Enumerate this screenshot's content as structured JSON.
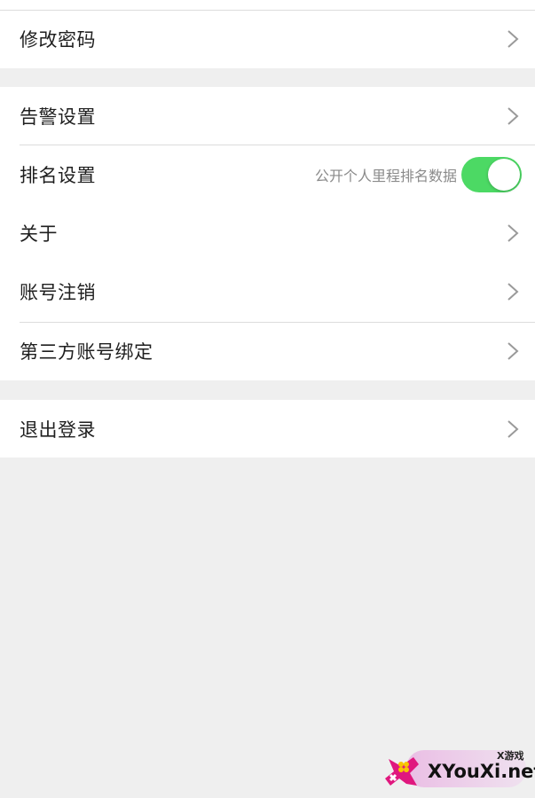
{
  "settings": {
    "change_password": "修改密码",
    "alarm_settings": "告警设置",
    "ranking_settings": "排名设置",
    "ranking_hint": "公开个人里程排名数据",
    "ranking_toggle_on": true,
    "about": "关于",
    "account_cancel": "账号注销",
    "third_party_binding": "第三方账号绑定",
    "logout": "退出登录"
  },
  "colors": {
    "toggle_on": "#4cd964",
    "background": "#efefef"
  },
  "watermark": {
    "small_text": "X游戏",
    "main_text": "XYouXi.net"
  }
}
